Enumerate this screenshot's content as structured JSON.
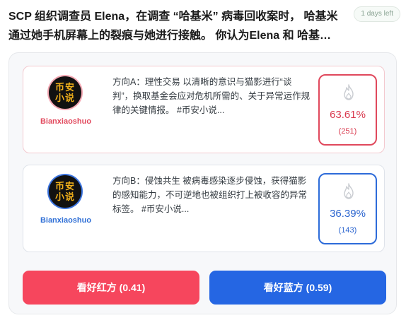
{
  "question": {
    "text": "SCP 组织调查员 Elena，在调查 “哈基米” 病毒回收案时， 哈基米通过她手机屏幕上的裂痕与她进行接触。 你认为Elena 和 哈基米会签订怎样的契约？",
    "days_left": "1 days left"
  },
  "options": [
    {
      "side": "red",
      "avatar_text": "币安小说",
      "author": "Bianxiaoshuo",
      "text": "方向A：理性交易 以清晰的意识与猫影进行“谈判”，换取基金会应对危机所需的、关于异常运作规律的关键情报。 #币安小说...",
      "percent": "63.61%",
      "count": "(251)",
      "color": "#e0485c",
      "icon": "fire-icon"
    },
    {
      "side": "blue",
      "avatar_text": "币安小说",
      "author": "Bianxiaoshuo",
      "text": "方向B：侵蚀共生 被病毒感染逐步侵蚀，获得猫影的感知能力，不可逆地也被组织打上被收容的异常标签。 #币安小说...",
      "percent": "36.39%",
      "count": "(143)",
      "color": "#2d6bd9",
      "icon": "fire-icon"
    }
  ],
  "buttons": {
    "red_label": "看好红方 (0.41)",
    "blue_label": "看好蓝方 (0.59)",
    "red_color": "#f6465d",
    "blue_color": "#2566e3"
  }
}
